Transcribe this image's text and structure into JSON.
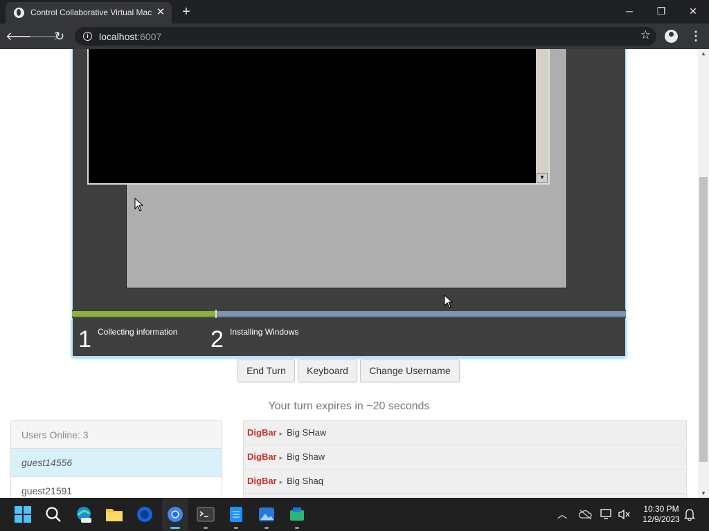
{
  "browser": {
    "tab_title": "Control Collaborative Virtual Mac",
    "url_host": "localhost",
    "url_port": ":6007",
    "window_controls": {
      "minimize": "─",
      "restore": "❐",
      "close": "✕"
    }
  },
  "vm": {
    "progress_fraction": 0.26,
    "steps": [
      {
        "number": "1",
        "label": "Collecting information"
      },
      {
        "number": "2",
        "label": "Installing Windows"
      }
    ]
  },
  "controls": {
    "end_turn": "End Turn",
    "keyboard": "Keyboard",
    "change_username": "Change Username"
  },
  "turn_message": "Your turn expires in ~20 seconds",
  "users_panel": {
    "header": "Users Online: 3",
    "users": [
      "guest14556",
      "guest21591"
    ]
  },
  "chat": {
    "messages": [
      {
        "name": "DigBar",
        "text": "Big SHaw"
      },
      {
        "name": "DigBar",
        "text": "Big Shaw"
      },
      {
        "name": "DigBar",
        "text": "Big Shaq"
      }
    ]
  },
  "taskbar": {
    "time": "10:30 PM",
    "date": "12/9/2023"
  }
}
